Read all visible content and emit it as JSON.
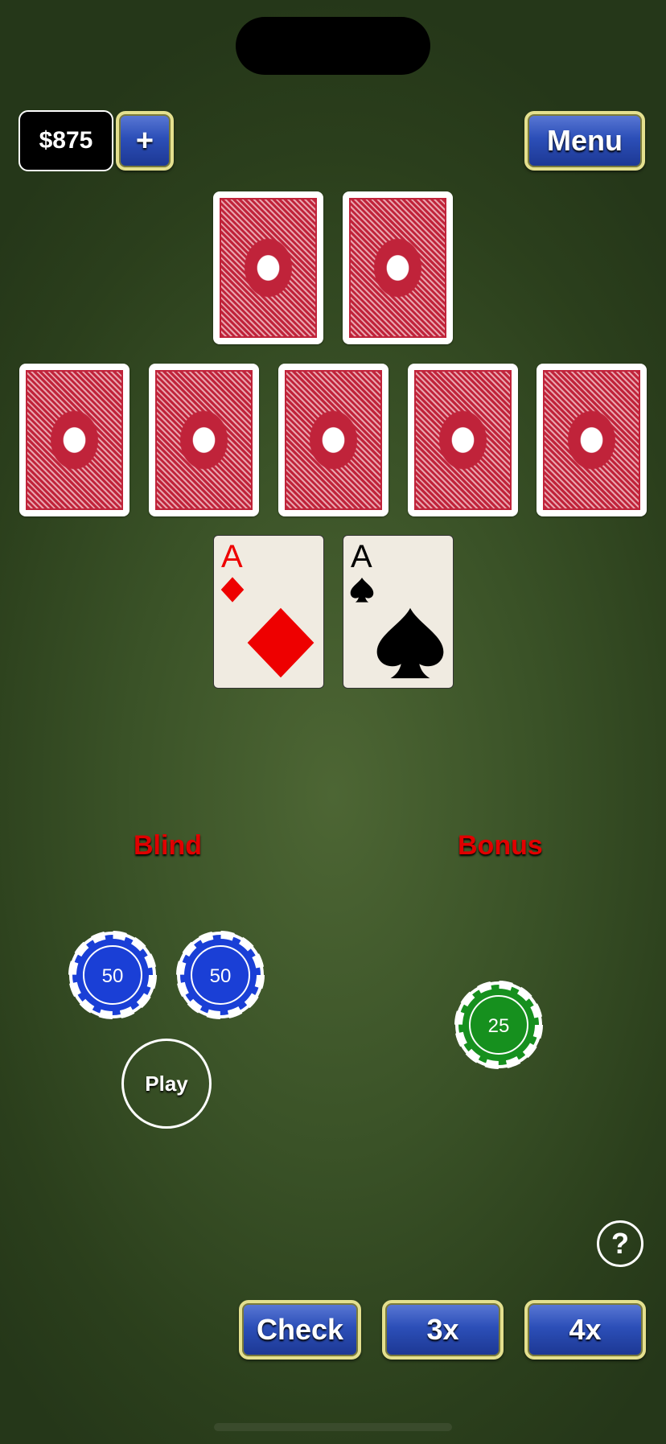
{
  "balance": {
    "amount": "$875",
    "add_label": "+"
  },
  "menu_label": "Menu",
  "dealer_cards": [
    {
      "face": "down"
    },
    {
      "face": "down"
    }
  ],
  "board_cards": [
    {
      "face": "down"
    },
    {
      "face": "down"
    },
    {
      "face": "down"
    },
    {
      "face": "down"
    },
    {
      "face": "down"
    }
  ],
  "player_cards": [
    {
      "rank": "A",
      "suit": "diamonds",
      "color": "#ee0000"
    },
    {
      "rank": "A",
      "suit": "spades",
      "color": "#000000"
    }
  ],
  "bet_areas": {
    "blind_label": "Blind",
    "bonus_label": "Bonus",
    "play_label": "Play"
  },
  "chips": [
    {
      "value": "50",
      "color": "#1a3fd6",
      "area": "blind"
    },
    {
      "value": "50",
      "color": "#1a3fd6",
      "area": "blind"
    },
    {
      "value": "25",
      "color": "#16901e",
      "area": "bonus"
    }
  ],
  "help_label": "?",
  "actions": {
    "check_label": "Check",
    "x3_label": "3x",
    "x4_label": "4x"
  }
}
